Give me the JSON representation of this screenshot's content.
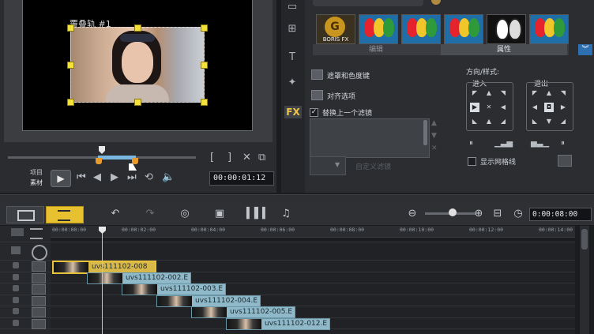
{
  "preview": {
    "overlay_label": "覆叠轨 #1",
    "mode_project": "项目",
    "mode_clip": "素材",
    "timecode": "00:00:01:12"
  },
  "filters": {
    "boris_label": "BORIS FX",
    "tab_edit": "编辑",
    "tab_attributes": "属性",
    "options": {
      "mask_chroma": "遮罩和色度键",
      "align": "对齐选项",
      "replace_last_filter": "替换上一个滤镜",
      "replace_last_filter_checked": true,
      "custom_filter": "自定义滤镜",
      "show_grid": "显示网格线",
      "show_grid_checked": false
    },
    "direction_style": "方向/样式:",
    "enter": "进入",
    "exit": "退出"
  },
  "timeline": {
    "duration": "0:00:08:00",
    "ruler_labels": [
      "00:00:00:00",
      "00:00:02:00",
      "00:00:04:00",
      "00:00:06:00",
      "00:00:08:00",
      "00:00:10:00",
      "00:00:12:00",
      "00:00:14:00"
    ],
    "clips": [
      {
        "name": "uvs111102-008",
        "selected": true
      },
      {
        "name": "uvs111102-002.E",
        "selected": false
      },
      {
        "name": "uvs111102-003.E",
        "selected": false
      },
      {
        "name": "uvs111102-004.E",
        "selected": false
      },
      {
        "name": "uvs111102-005.E",
        "selected": false
      },
      {
        "name": "uvs111102-012.E",
        "selected": false
      }
    ]
  }
}
